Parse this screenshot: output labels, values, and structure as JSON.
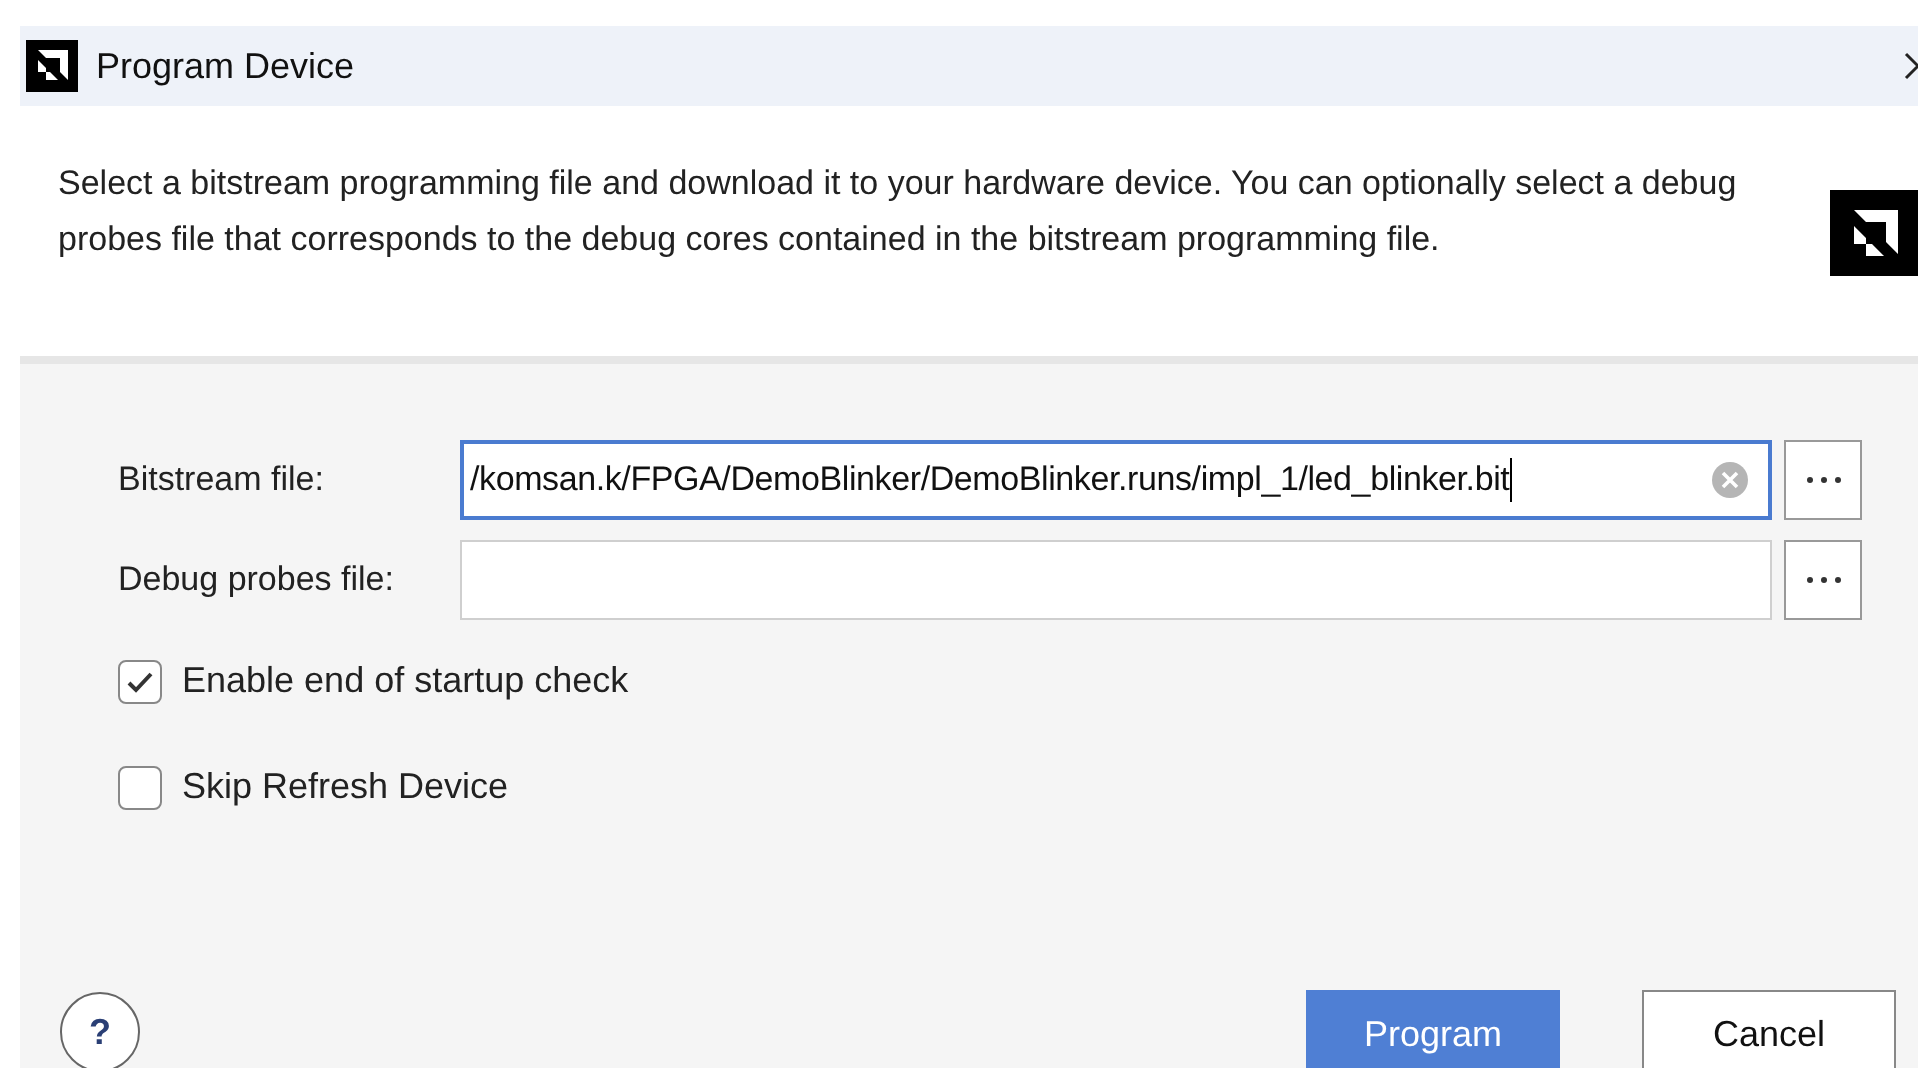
{
  "window": {
    "title": "Program Device"
  },
  "description": "Select a bitstream programming file and download it to your hardware device. You can optionally select a debug probes file that corresponds to the debug cores contained in the bitstream programming file.",
  "fields": [
    {
      "label": "Bitstream file:",
      "value": "/komsan.k/FPGA/DemoBlinker/DemoBlinker.runs/impl_1/led_blinker.bit",
      "focused": true
    },
    {
      "label": "Debug probes file:",
      "focused": false
    }
  ],
  "options": [
    {
      "label": "Enable end of startup check",
      "checked": true
    },
    {
      "label": "Skip Refresh Device",
      "checked": false
    }
  ],
  "help": "?",
  "buttons": [
    {
      "label": "Program",
      "primary": true
    },
    {
      "label": "Cancel",
      "primary": false
    }
  ]
}
